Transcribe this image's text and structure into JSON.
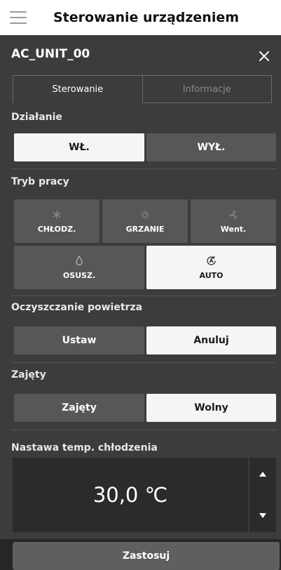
{
  "header": {
    "title": "Sterowanie urządzeniem"
  },
  "unit": {
    "name": "AC_UNIT_00"
  },
  "tabs": [
    {
      "label": "Sterowanie",
      "active": true
    },
    {
      "label": "Informacje",
      "active": false
    }
  ],
  "operation": {
    "label": "Działanie",
    "buttons": [
      {
        "label": "WŁ.",
        "selected": true
      },
      {
        "label": "WYŁ.",
        "selected": false
      }
    ]
  },
  "mode": {
    "label": "Tryb pracy",
    "options": [
      {
        "label": "CHŁODZ.",
        "icon": "snowflake-icon",
        "selected": false
      },
      {
        "label": "GRZANIE",
        "icon": "sun-icon",
        "selected": false
      },
      {
        "label": "Went.",
        "icon": "fan-icon",
        "selected": false
      },
      {
        "label": "OSUSZ.",
        "icon": "droplet-icon",
        "selected": false
      },
      {
        "label": "AUTO",
        "icon": "auto-icon",
        "selected": true
      }
    ]
  },
  "air_purification": {
    "label": "Oczyszczanie powietrza",
    "buttons": [
      {
        "label": "Ustaw",
        "selected": false
      },
      {
        "label": "Anuluj",
        "selected": true
      }
    ]
  },
  "occupancy": {
    "label": "Zajęty",
    "buttons": [
      {
        "label": "Zajęty",
        "selected": false
      },
      {
        "label": "Wolny",
        "selected": true
      }
    ]
  },
  "setpoint": {
    "label": "Nastawa temp. chłodzenia",
    "value": "30,0 ℃"
  },
  "apply": {
    "label": "Zastosuj"
  }
}
